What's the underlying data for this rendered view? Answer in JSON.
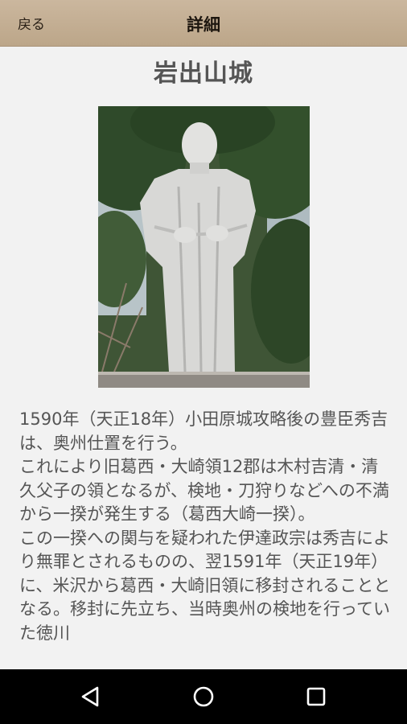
{
  "header": {
    "back_label": "戻る",
    "title": "詳細"
  },
  "article": {
    "title": "岩出山城",
    "photo_icon": "statue-photo",
    "paragraphs": [
      "1590年（天正18年）小田原城攻略後の豊臣秀吉は、奥州仕置を行う。",
      "これにより旧葛西・大崎領12郡は木村吉清・清久父子の領となるが、検地・刀狩りなどへの不満から一揆が発生する（葛西大崎一揆）。",
      "この一揆への関与を疑われた伊達政宗は秀吉により無罪とされるものの、翌1591年（天正19年）に、米沢から葛西・大崎旧領に移封されることとなる。移封に先立ち、当時奥州の検地を行っていた徳川"
    ]
  },
  "navigation": {
    "back_icon": "triangle-back-icon",
    "home_icon": "circle-home-icon",
    "recents_icon": "square-recents-icon"
  }
}
